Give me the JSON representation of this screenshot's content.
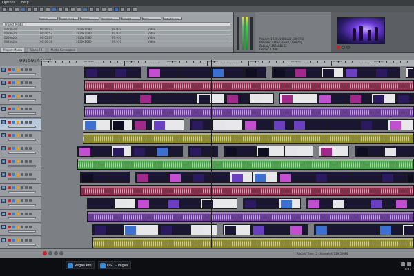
{
  "window": {
    "title": "Vegas Pro"
  },
  "menu": {
    "items": [
      "Options",
      "Help"
    ]
  },
  "explorer": {
    "tabs": [
      "Explorer",
      "Project Media",
      "Trimmer",
      "Transitions",
      "Video FX",
      "Media Generators",
      "Media Manager"
    ],
    "header": "Project Media",
    "rows": [
      {
        "c1": "001.m2ts",
        "c2": "00:00:47",
        "c3": "1920x1080",
        "c4": "29.970",
        "c5": "Video"
      },
      {
        "c1": "002.m2ts",
        "c2": "00:00:52",
        "c3": "1920x1080",
        "c4": "29.970",
        "c5": "Video"
      },
      {
        "c1": "003.m2ts",
        "c2": "00:01:03",
        "c3": "1920x1080",
        "c4": "29.970",
        "c5": "Video"
      },
      {
        "c1": "004.m2ts",
        "c2": "00:00:38",
        "c3": "1920x1080",
        "c4": "29.970",
        "c5": "Video"
      }
    ]
  },
  "window_tabs": {
    "items": [
      "Project Media",
      "Video FX",
      "Media Generators"
    ],
    "active_index": 0
  },
  "properties": {
    "lines": [
      "Project: 1920x1080x32, 29.970i",
      "Preview: 480x270x32, 29.970p",
      "Display: 156x88x32",
      "Frame: 1,406"
    ]
  },
  "timeline": {
    "timecode": "00:50:47:00",
    "ruler_labels": [
      "00:50:30",
      "00:50:40",
      "00:50:50",
      "00:51:00",
      "00:51:10",
      "00:51:20",
      "00:51:30",
      "00:51:40",
      "00:51:50"
    ],
    "marker_label": "Marker 00"
  },
  "tracks": [
    {
      "index": "1",
      "kind": "video"
    },
    {
      "index": "2",
      "kind": "audio",
      "color": "#8b2a4a"
    },
    {
      "index": "3",
      "kind": "video"
    },
    {
      "index": "4",
      "kind": "audio",
      "color": "#6a3a9a"
    },
    {
      "index": "5",
      "kind": "video",
      "selected": true
    },
    {
      "index": "6",
      "kind": "audio",
      "color": "#8c8a2a"
    },
    {
      "index": "7",
      "kind": "video"
    },
    {
      "index": "8",
      "kind": "audio",
      "color": "#4aa34a"
    },
    {
      "index": "9",
      "kind": "video"
    },
    {
      "index": "10",
      "kind": "audio",
      "color": "#8b2a4a"
    },
    {
      "index": "11",
      "kind": "video"
    },
    {
      "index": "12",
      "kind": "audio",
      "color": "#6a3a9a"
    },
    {
      "index": "13",
      "kind": "video"
    },
    {
      "index": "14",
      "kind": "audio",
      "color": "#8c8a2a"
    }
  ],
  "status": {
    "text": "Record Time (2 channels): 119:59:44"
  },
  "taskbar": {
    "apps": [
      "Vegas Pro",
      "DSC - Vegas"
    ],
    "clock": "10:42"
  },
  "colors": {
    "selected_track": "#b7c7dc",
    "playhead": "#1e1e1e"
  },
  "icons": [
    "play-icon",
    "stop-icon",
    "record-icon",
    "loop-icon",
    "solo-icon",
    "mute-icon"
  ]
}
